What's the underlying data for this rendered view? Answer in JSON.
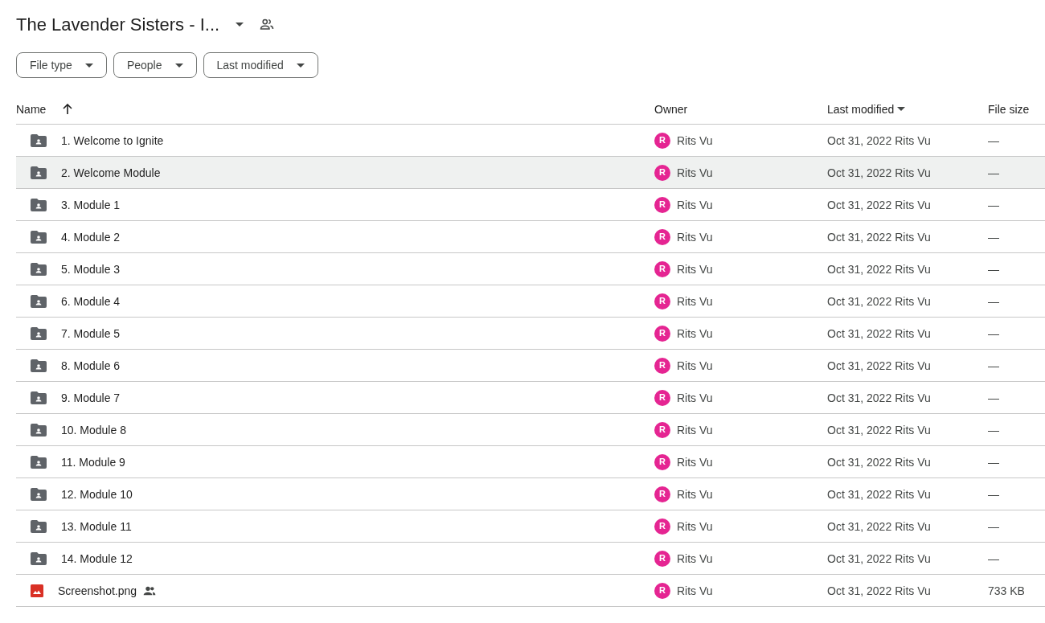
{
  "title": "The Lavender Sisters - I...",
  "filters": [
    "File type",
    "People",
    "Last modified"
  ],
  "columns": [
    {
      "label": "Name",
      "kind": "arrow"
    },
    {
      "label": "Owner",
      "kind": "plain"
    },
    {
      "label": "Last modified",
      "kind": "caret"
    },
    {
      "label": "File size",
      "kind": "plain"
    }
  ],
  "rows": [
    {
      "name": "1. Welcome to Ignite",
      "kind": "folder",
      "shared": false,
      "selected": false,
      "avatar": "R",
      "owner": "Rits Vu",
      "modified": "Oct 31, 2022",
      "modified_by": "Rits Vu",
      "size": "—"
    },
    {
      "name": "2. Welcome Module",
      "kind": "folder",
      "shared": false,
      "selected": true,
      "avatar": "R",
      "owner": "Rits Vu",
      "modified": "Oct 31, 2022",
      "modified_by": "Rits Vu",
      "size": "—"
    },
    {
      "name": "3. Module 1",
      "kind": "folder",
      "shared": false,
      "selected": false,
      "avatar": "R",
      "owner": "Rits Vu",
      "modified": "Oct 31, 2022",
      "modified_by": "Rits Vu",
      "size": "—"
    },
    {
      "name": "4. Module 2",
      "kind": "folder",
      "shared": false,
      "selected": false,
      "avatar": "R",
      "owner": "Rits Vu",
      "modified": "Oct 31, 2022",
      "modified_by": "Rits Vu",
      "size": "—"
    },
    {
      "name": "5. Module 3",
      "kind": "folder",
      "shared": false,
      "selected": false,
      "avatar": "R",
      "owner": "Rits Vu",
      "modified": "Oct 31, 2022",
      "modified_by": "Rits Vu",
      "size": "—"
    },
    {
      "name": "6. Module 4",
      "kind": "folder",
      "shared": false,
      "selected": false,
      "avatar": "R",
      "owner": "Rits Vu",
      "modified": "Oct 31, 2022",
      "modified_by": "Rits Vu",
      "size": "—"
    },
    {
      "name": "7. Module 5",
      "kind": "folder",
      "shared": false,
      "selected": false,
      "avatar": "R",
      "owner": "Rits Vu",
      "modified": "Oct 31, 2022",
      "modified_by": "Rits Vu",
      "size": "—"
    },
    {
      "name": "8. Module 6",
      "kind": "folder",
      "shared": false,
      "selected": false,
      "avatar": "R",
      "owner": "Rits Vu",
      "modified": "Oct 31, 2022",
      "modified_by": "Rits Vu",
      "size": "—"
    },
    {
      "name": "9. Module 7",
      "kind": "folder",
      "shared": false,
      "selected": false,
      "avatar": "R",
      "owner": "Rits Vu",
      "modified": "Oct 31, 2022",
      "modified_by": "Rits Vu",
      "size": "—"
    },
    {
      "name": "10. Module 8",
      "kind": "folder",
      "shared": false,
      "selected": false,
      "avatar": "R",
      "owner": "Rits Vu",
      "modified": "Oct 31, 2022",
      "modified_by": "Rits Vu",
      "size": "—"
    },
    {
      "name": "11. Module 9",
      "kind": "folder",
      "shared": false,
      "selected": false,
      "avatar": "R",
      "owner": "Rits Vu",
      "modified": "Oct 31, 2022",
      "modified_by": "Rits Vu",
      "size": "—"
    },
    {
      "name": "12. Module 10",
      "kind": "folder",
      "shared": false,
      "selected": false,
      "avatar": "R",
      "owner": "Rits Vu",
      "modified": "Oct 31, 2022",
      "modified_by": "Rits Vu",
      "size": "—"
    },
    {
      "name": "13. Module 11",
      "kind": "folder",
      "shared": false,
      "selected": false,
      "avatar": "R",
      "owner": "Rits Vu",
      "modified": "Oct 31, 2022",
      "modified_by": "Rits Vu",
      "size": "—"
    },
    {
      "name": "14. Module 12",
      "kind": "folder",
      "shared": false,
      "selected": false,
      "avatar": "R",
      "owner": "Rits Vu",
      "modified": "Oct 31, 2022",
      "modified_by": "Rits Vu",
      "size": "—"
    },
    {
      "name": "Screenshot.png",
      "kind": "image",
      "shared": true,
      "selected": false,
      "avatar": "R",
      "owner": "Rits Vu",
      "modified": "Oct 31, 2022",
      "modified_by": "Rits Vu",
      "size": "733 KB"
    }
  ]
}
